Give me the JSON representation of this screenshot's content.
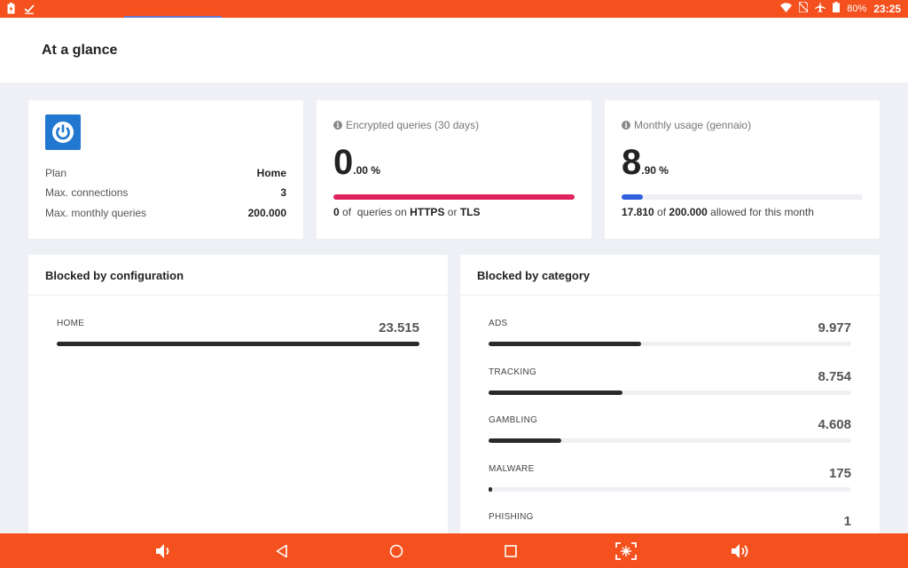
{
  "status_bar": {
    "battery_percent": "80%",
    "time": "23:25"
  },
  "header": {
    "title": "At a glance"
  },
  "plan_card": {
    "rows": [
      {
        "label": "Plan",
        "value": "Home"
      },
      {
        "label": "Max. connections",
        "value": "3"
      },
      {
        "label": "Max. monthly queries",
        "value": "200.000"
      }
    ]
  },
  "encrypted_card": {
    "label": "Encrypted queries (30 days)",
    "integer": "0",
    "decimal": ".00 %",
    "progress": 1.0,
    "color": "#e0235f",
    "footer": {
      "count": "0",
      "of": "of",
      "mid": "queries on",
      "https": "HTTPS",
      "or": "or",
      "tls": "TLS"
    }
  },
  "monthly_card": {
    "label": "Monthly usage (gennaio)",
    "integer": "8",
    "decimal": ".90 %",
    "progress": 0.089,
    "color": "#2f5fdd",
    "footer": {
      "used": "17.810",
      "of": "of",
      "total": "200.000",
      "rest": "allowed for this month"
    }
  },
  "config_panel": {
    "title": "Blocked by configuration",
    "items": [
      {
        "name": "HOME",
        "value": "23.515",
        "fraction": 1.0
      }
    ]
  },
  "category_panel": {
    "title": "Blocked by category",
    "items": [
      {
        "name": "ADS",
        "value": "9.977",
        "fraction": 0.42
      },
      {
        "name": "TRACKING",
        "value": "8.754",
        "fraction": 0.37
      },
      {
        "name": "GAMBLING",
        "value": "4.608",
        "fraction": 0.2
      },
      {
        "name": "MALWARE",
        "value": "175",
        "fraction": 0.008
      },
      {
        "name": "PHISHING",
        "value": "1",
        "fraction": 0.0
      }
    ]
  },
  "colors": {
    "accent": "#f4511e",
    "brand": "#2277d1",
    "bar_dark": "#2a2a2a"
  },
  "icons": {
    "status_left": [
      "battery-charging-icon",
      "checkmark-icon"
    ],
    "status_right": [
      "wifi-icon",
      "no-sim-icon",
      "airplane-icon",
      "battery-icon"
    ],
    "nav": [
      "volume-down-icon",
      "back-icon",
      "home-icon",
      "recents-icon",
      "screenshot-icon",
      "volume-up-icon"
    ]
  }
}
